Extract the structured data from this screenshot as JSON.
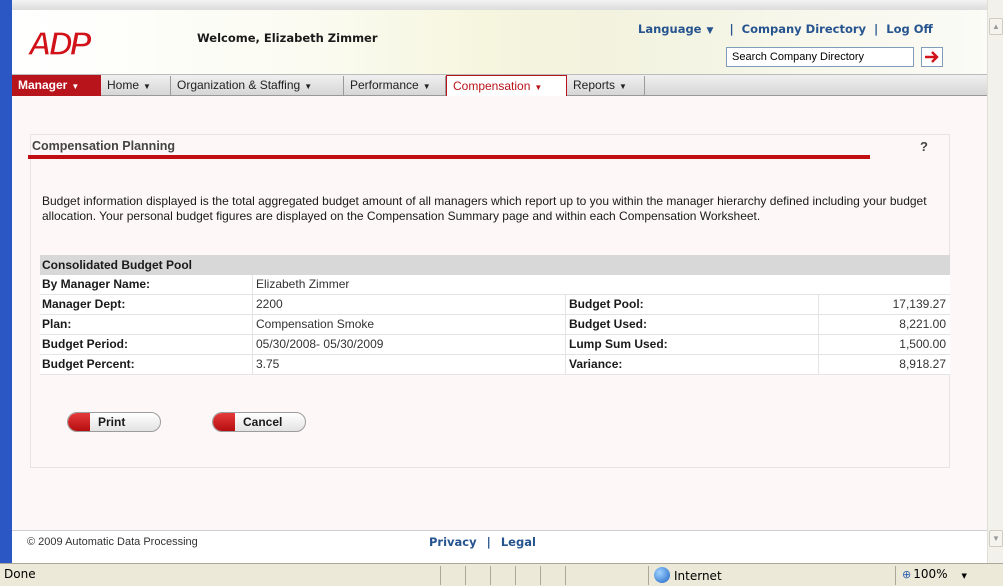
{
  "header": {
    "logo_text": "ADP",
    "welcome": "Welcome, Elizabeth Zimmer",
    "language_label": "Language",
    "company_directory": "Company Directory",
    "log_off": "Log Off",
    "search_value": "Search Company Directory"
  },
  "nav": {
    "manager": "Manager",
    "items": [
      {
        "label": "Home"
      },
      {
        "label": "Organization & Staffing"
      },
      {
        "label": "Performance"
      },
      {
        "label": "Compensation"
      },
      {
        "label": "Reports"
      }
    ]
  },
  "page": {
    "title": "Compensation Planning",
    "help": "?",
    "intro": "Budget information displayed is the total aggregated budget amount of all managers which report up to you within the manager hierarchy defined including your budget allocation. Your personal budget figures are displayed on the Compensation Summary page and within each Compensation Worksheet."
  },
  "budget": {
    "section_title": "Consolidated Budget Pool",
    "rows": [
      {
        "label": "By Manager Name:",
        "value": "Elizabeth Zimmer",
        "label2": "",
        "value2": ""
      },
      {
        "label": "Manager Dept:",
        "value": "2200",
        "label2": "Budget Pool:",
        "value2": "17,139.27"
      },
      {
        "label": "Plan:",
        "value": "Compensation Smoke",
        "label2": "Budget Used:",
        "value2": "8,221.00"
      },
      {
        "label": "Budget Period:",
        "value": "05/30/2008- 05/30/2009",
        "label2": "Lump Sum Used:",
        "value2": "1,500.00"
      },
      {
        "label": "Budget Percent:",
        "value": "3.75",
        "label2": "Variance:",
        "value2": "8,918.27"
      }
    ]
  },
  "buttons": {
    "print": "Print",
    "cancel": "Cancel"
  },
  "footer": {
    "copyright": "© 2009 Automatic Data Processing",
    "privacy": "Privacy",
    "legal": "Legal"
  },
  "statusbar": {
    "status": "Done",
    "zone": "Internet",
    "zoom": "100%"
  },
  "colors": {
    "brand_red": "#c00e12",
    "link_blue": "#25548f"
  }
}
